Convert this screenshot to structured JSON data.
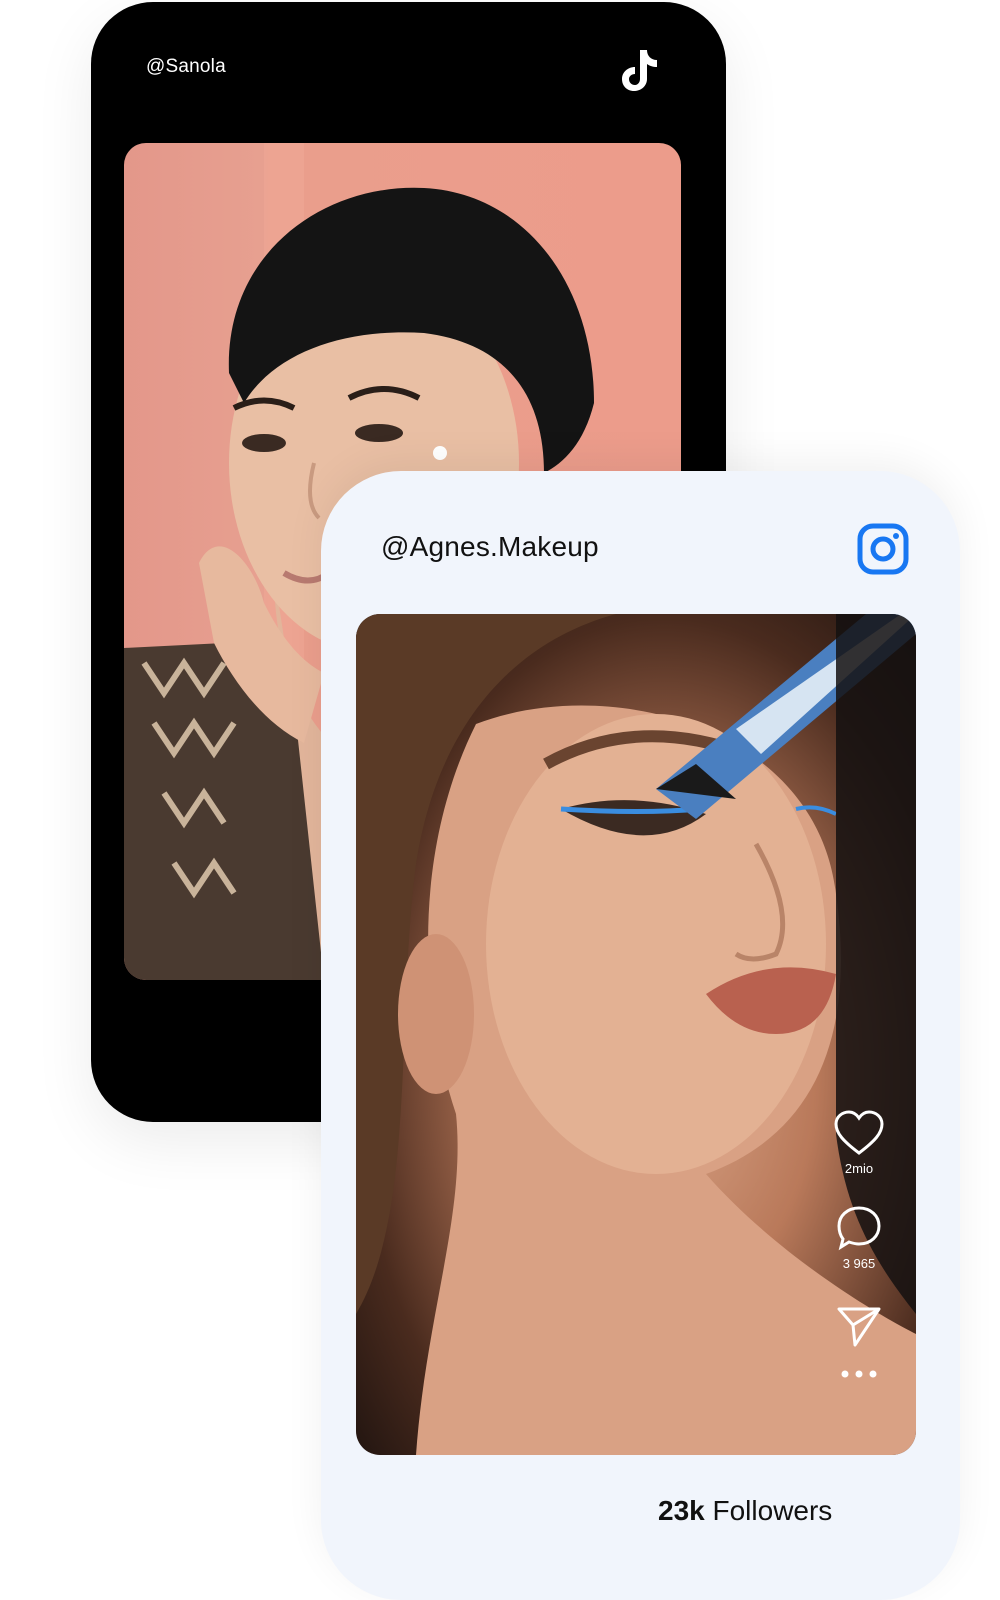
{
  "tiktok": {
    "handle": "@Sanola",
    "logo_icon": "tiktok-logo-icon"
  },
  "instagram": {
    "handle": "@Agnes.Makeup",
    "logo_icon": "instagram-logo-icon",
    "accent": "#1877f2",
    "actions": {
      "likes": "2mio",
      "comments": "3 965",
      "like_icon": "heart-icon",
      "comment_icon": "comment-icon",
      "share_icon": "send-icon",
      "more_icon": "more-icon"
    },
    "followers_count": "23k",
    "followers_label": "Followers"
  }
}
